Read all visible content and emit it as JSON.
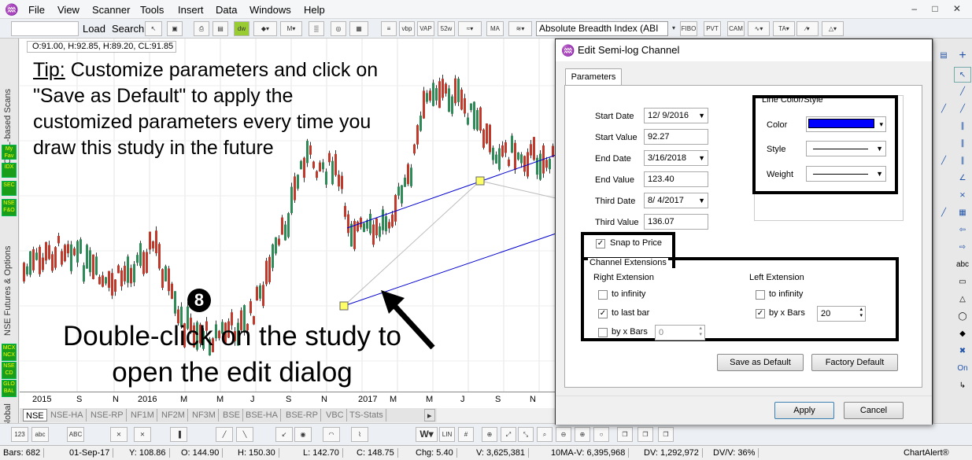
{
  "menu": {
    "items": [
      "File",
      "View",
      "Scanner",
      "Tools",
      "Insert",
      "Data",
      "Windows",
      "Help"
    ]
  },
  "toolbar": {
    "load": "Load",
    "search": "Search",
    "study_select": "Absolute Breadth Index (ABI"
  },
  "sidebar": {
    "scans": "CASL-based Scans",
    "futures": "NSE Futures & Options",
    "global": "Global",
    "tiles": [
      "My Fav",
      "IDX",
      "SEC",
      "NSE F&O",
      "MCX NCX",
      "NSE CD",
      "GLO BAL"
    ]
  },
  "chart": {
    "ohlc": "O:91.00, H:92.85, H:89.20, CL:91.85",
    "tip_label": "Tip:",
    "tip_text": " Customize parameters and click on \"Save as Default\" to apply the customized parameters every time you draw this study in the future",
    "step": "8",
    "instruction": "Double-click on the study to open the edit dialog",
    "x_labels": [
      "2015",
      "S",
      "N",
      "2016",
      "M",
      "M",
      "J",
      "S",
      "N",
      "2017",
      "M",
      "M",
      "J",
      "S",
      "N"
    ],
    "candle_color_up": "#2e8b57",
    "candle_color_down": "#c0392b"
  },
  "tabs": [
    "NSE",
    "NSE-HA",
    "NSE-RP",
    "NF1M",
    "NF2M",
    "NF3M",
    "BSE",
    "BSE-HA",
    "BSE-RP",
    "VBC",
    "TS-Stats"
  ],
  "status": {
    "bars": "Bars: 682",
    "date": "01-Sep-17",
    "y": "Y: 108.86",
    "o": "O: 144.90",
    "h": "H: 150.30",
    "l": "L: 142.70",
    "c": "C: 148.75",
    "chg": "Chg: 5.40",
    "v": "V: 3,625,381",
    "ma": "10MA-V: 6,395,968",
    "dv": "DV: 1,292,972",
    "dvv": "DV/V: 36%",
    "brand": "ChartAlert®"
  },
  "right": {
    "on": "On",
    "abc": "abc"
  },
  "dialog": {
    "title": "Edit Semi-log Channel",
    "tab": "Parameters",
    "start_date_label": "Start Date",
    "start_date": "12/ 9/2016",
    "start_value_label": "Start Value",
    "start_value": "92.27",
    "end_date_label": "End Date",
    "end_date": "3/16/2018",
    "end_value_label": "End Value",
    "end_value": "123.40",
    "third_date_label": "Third Date",
    "third_date": "8/ 4/2017",
    "third_value_label": "Third Value",
    "third_value": "136.07",
    "line_group": "Line Color/Style",
    "color_label": "Color",
    "color": "#0000ff",
    "style_label": "Style",
    "weight_label": "Weight",
    "snap_label": "Snap to Price",
    "ext_group": "Channel Extensions",
    "right_ext": "Right Extension",
    "left_ext": "Left Extension",
    "to_infinity": "to infinity",
    "to_last_bar": "to last bar",
    "by_x_bars": "by x Bars",
    "right_bars": "0",
    "left_bars": "20",
    "save_default": "Save as Default",
    "factory_default": "Factory Default",
    "apply": "Apply",
    "cancel": "Cancel"
  }
}
